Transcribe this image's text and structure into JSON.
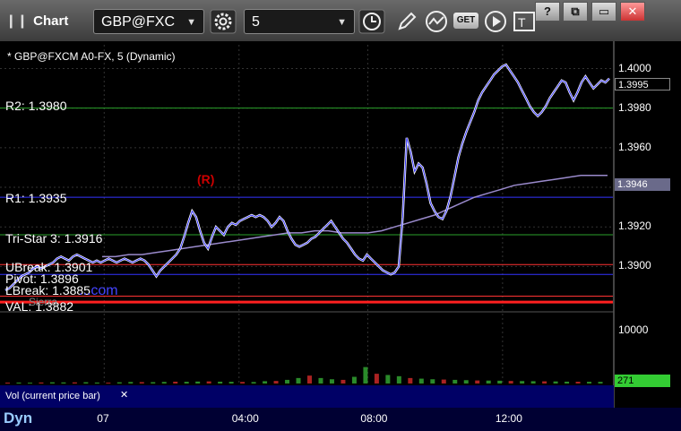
{
  "window": {
    "title": "Chart",
    "symbol": "GBP@FXC",
    "interval": "5",
    "controls": [
      "?",
      "⧉",
      "▭",
      "✕"
    ]
  },
  "toolbar": {
    "icons": [
      "gear-icon",
      "clock-icon",
      "pencil-icon",
      "indicator-icon",
      "get-icon",
      "play-icon",
      "text-icon"
    ],
    "get_label": "GET"
  },
  "chart": {
    "caption": "* GBP@FXCM A0-FX, 5 (Dynamic)",
    "levels": [
      {
        "label": "R2: 1.3980",
        "value": 1.398,
        "color": "#2aa02a"
      },
      {
        "label": "R1: 1.3935",
        "value": 1.3935,
        "color": "#3333ff"
      },
      {
        "label": "Tri-Star 3: 1.3916",
        "value": 1.3916,
        "color": "#2aa02a"
      },
      {
        "label": "UBreak: 1.3901",
        "value": 1.3901,
        "color": "#ff3333"
      },
      {
        "label": "Pivot: 1.3896",
        "value": 1.3896,
        "color": "#3333ff"
      },
      {
        "label": "LBreak: 1.3885",
        "value": 1.3885,
        "color": "#ff3333"
      },
      {
        "label": "VAL: 1.3882",
        "value": 1.3882,
        "color": "#ff2020"
      }
    ],
    "watermark": "Sierra",
    "site_tag": "...com",
    "r_marker": "(R)",
    "last_price": "1.3995",
    "ma_price": "1.3946",
    "volume": {
      "label": "Vol (current price bar)",
      "max_label": "10000",
      "last_label": "271"
    },
    "footer": "Dyn"
  },
  "chart_data": {
    "type": "line",
    "title": "* GBP@FXCM A0-FX, 5 (Dynamic)",
    "x_ticks": [
      "07",
      "04:00",
      "08:00",
      "12:00"
    ],
    "y_ticks": [
      1.39,
      1.392,
      1.394,
      1.396,
      1.398,
      1.4
    ],
    "ylim": [
      1.3878,
      1.4012
    ],
    "series": [
      {
        "values": [
          1.3888,
          1.3889,
          1.3891,
          1.3893,
          1.3895,
          1.3896,
          1.3897,
          1.3899,
          1.39,
          1.3899,
          1.39,
          1.3901,
          1.3902,
          1.3904,
          1.3905,
          1.3904,
          1.3903,
          1.3905,
          1.3906,
          1.3905,
          1.3904,
          1.3903,
          1.3902,
          1.3903,
          1.3902,
          1.3903,
          1.3904,
          1.3903,
          1.3902,
          1.3903,
          1.3904,
          1.3903,
          1.3902,
          1.3903,
          1.3904,
          1.3903,
          1.3901,
          1.3898,
          1.3895,
          1.3898,
          1.39,
          1.3902,
          1.3904,
          1.3906,
          1.3909,
          1.3915,
          1.3922,
          1.3928,
          1.3925,
          1.3918,
          1.3912,
          1.3909,
          1.3915,
          1.392,
          1.3918,
          1.3916,
          1.392,
          1.3922,
          1.3921,
          1.3923,
          1.3924,
          1.3925,
          1.3926,
          1.3925,
          1.3926,
          1.3925,
          1.3923,
          1.392,
          1.3922,
          1.3925,
          1.3923,
          1.3918,
          1.3914,
          1.3911,
          1.391,
          1.3911,
          1.3912,
          1.3914,
          1.3915,
          1.3917,
          1.3919,
          1.3921,
          1.3923,
          1.392,
          1.3917,
          1.3914,
          1.3912,
          1.3909,
          1.3906,
          1.3904,
          1.3903,
          1.3906,
          1.3904,
          1.3902,
          1.39,
          1.3898,
          1.3897,
          1.3896,
          1.3897,
          1.39,
          1.3925,
          1.3965,
          1.3958,
          1.3948,
          1.3952,
          1.395,
          1.3942,
          1.3932,
          1.3928,
          1.3925,
          1.3924,
          1.3928,
          1.3935,
          1.3945,
          1.3955,
          1.3962,
          1.3968,
          1.3973,
          1.3978,
          1.3984,
          1.3988,
          1.3991,
          1.3994,
          1.3997,
          1.3999,
          1.4001,
          1.4002,
          1.3999,
          1.3996,
          1.3993,
          1.3989,
          1.3985,
          1.3981,
          1.3978,
          1.3976,
          1.3978,
          1.3981,
          1.3985,
          1.3988,
          1.3991,
          1.3994,
          1.3993,
          1.3988,
          1.3984,
          1.3988,
          1.3993,
          1.3996,
          1.3993,
          1.399,
          1.3992,
          1.3994,
          1.3993,
          1.3995
        ]
      },
      {
        "name": "",
        "values": [
          1.3905,
          1.3905,
          1.3906,
          1.3906,
          1.3907,
          1.3908,
          1.3909,
          1.391,
          1.3911,
          1.3912,
          1.3913,
          1.3914,
          1.3915,
          1.3916,
          1.3917,
          1.3917,
          1.3918,
          1.3918,
          1.3917,
          1.3917,
          1.3917,
          1.3918,
          1.392,
          1.3922,
          1.3924,
          1.3926,
          1.3929,
          1.3932,
          1.3935,
          1.3937,
          1.3939,
          1.3941,
          1.3942,
          1.3943,
          1.3944,
          1.3945,
          1.3946,
          1.3946,
          1.3946
        ]
      }
    ],
    "volume": [
      150,
      160,
      140,
      170,
      200,
      180,
      190,
      210,
      160,
      140,
      200,
      250,
      230,
      220,
      260,
      300,
      280,
      320,
      350,
      300,
      280,
      260,
      240,
      380,
      420,
      600,
      900,
      1300,
      900,
      700,
      600,
      1100,
      2700,
      1600,
      1400,
      1200,
      900,
      800,
      700,
      650,
      600,
      550,
      500,
      480,
      460,
      420,
      400,
      380,
      360,
      340,
      300,
      290,
      280,
      271
    ],
    "volume_max": 10000
  }
}
